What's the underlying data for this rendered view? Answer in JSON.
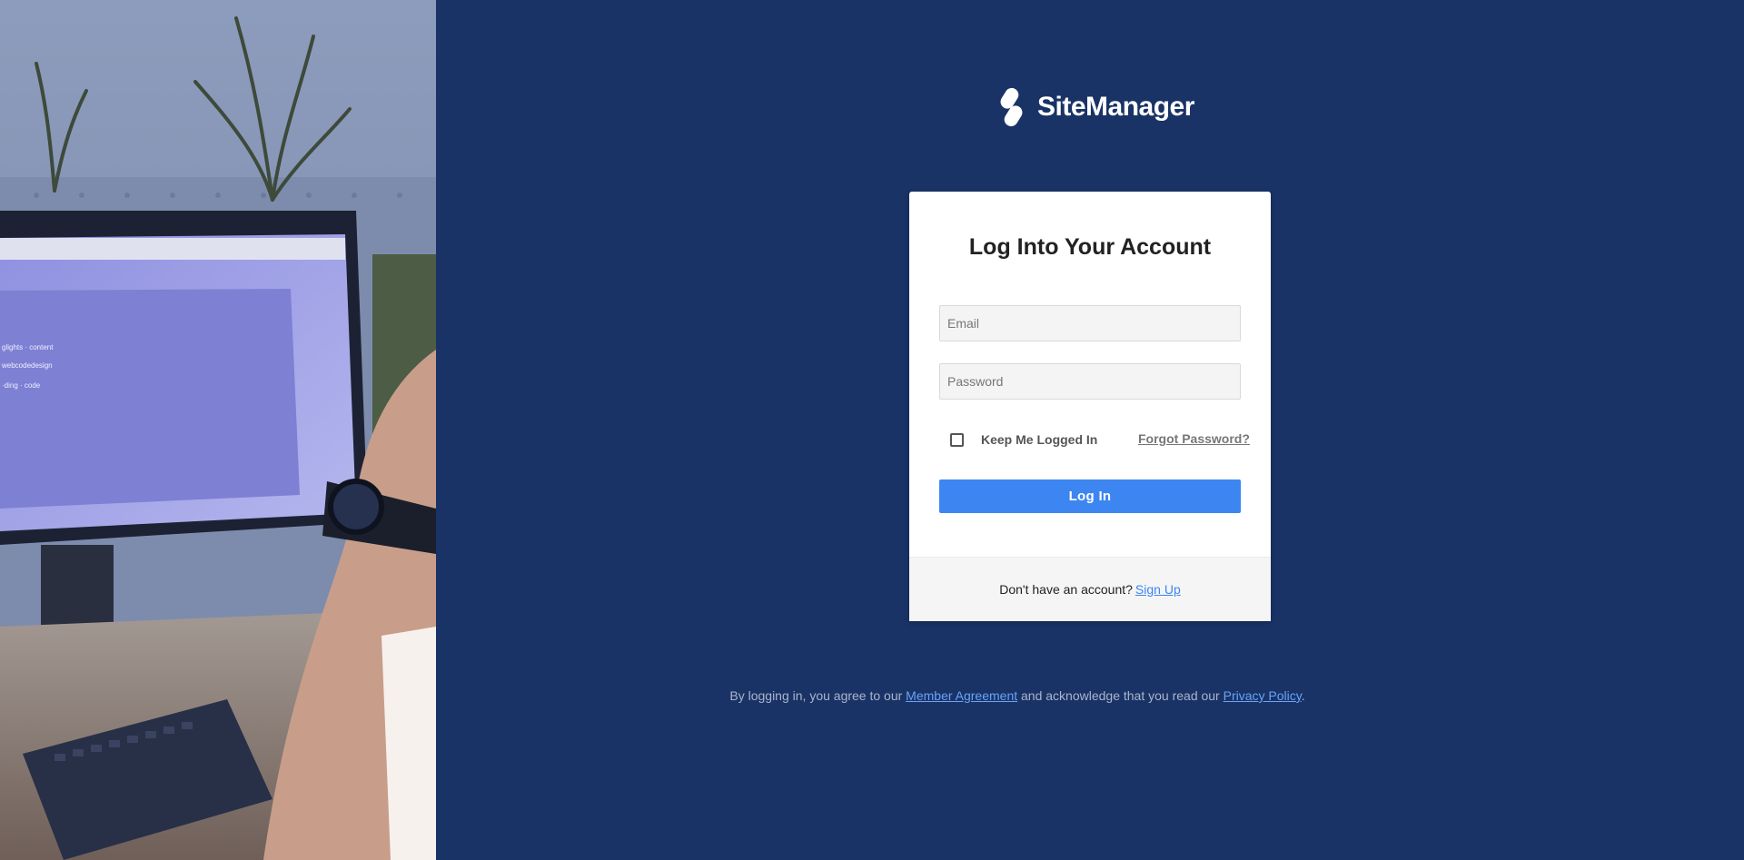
{
  "brand": {
    "name": "SiteManager",
    "logo_icon": "sitemanager-logo-icon",
    "background_color": "#1a3366",
    "accent_color": "#3d86f1"
  },
  "photo_panel": {
    "description_icon": "workspace-photo"
  },
  "login_card": {
    "title": "Log Into Your Account",
    "email": {
      "value": "",
      "placeholder": "Email"
    },
    "password": {
      "value": "",
      "placeholder": "Password"
    },
    "remember_me": {
      "label": "Keep Me Logged In",
      "checked": false
    },
    "forgot_password_label": "Forgot Password?",
    "submit_label": "Log In",
    "footer": {
      "prompt": "Don't have an account?",
      "signup_label": "Sign Up"
    }
  },
  "terms": {
    "prefix": "By logging in, you agree to our ",
    "member_agreement_label": "Member Agreement",
    "middle": " and acknowledge that you read our ",
    "privacy_policy_label": "Privacy Policy",
    "suffix": "."
  }
}
